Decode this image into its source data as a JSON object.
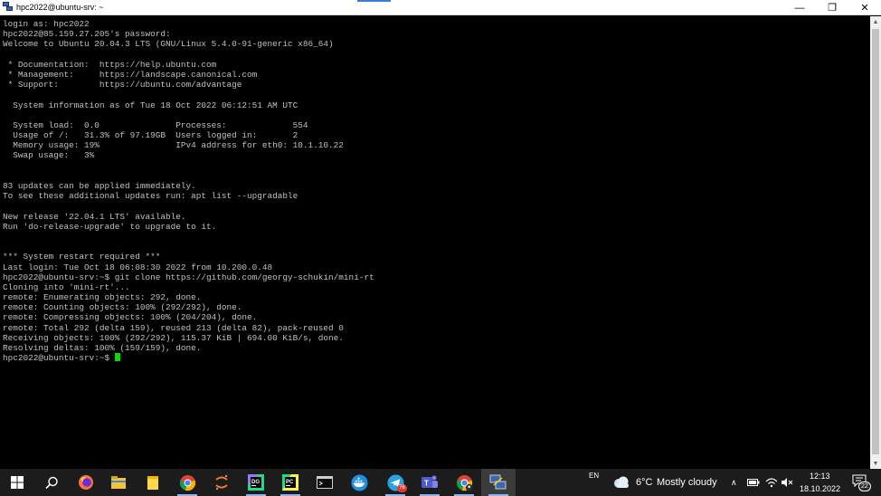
{
  "window": {
    "title": "hpc2022@ubuntu-srv: ~",
    "minimize_glyph": "—",
    "maximize_glyph": "❐",
    "close_glyph": "✕"
  },
  "terminal": {
    "lines": [
      "login as: hpc2022",
      "hpc2022@85.159.27.205's password:",
      "Welcome to Ubuntu 20.04.3 LTS (GNU/Linux 5.4.0-91-generic x86_64)",
      "",
      " * Documentation:  https://help.ubuntu.com",
      " * Management:     https://landscape.canonical.com",
      " * Support:        https://ubuntu.com/advantage",
      "",
      "  System information as of Tue 18 Oct 2022 06:12:51 AM UTC",
      "",
      "  System load:  0.0               Processes:             554",
      "  Usage of /:   31.3% of 97.19GB  Users logged in:       2",
      "  Memory usage: 19%               IPv4 address for eth0: 10.1.10.22",
      "  Swap usage:   3%",
      "",
      "",
      "83 updates can be applied immediately.",
      "To see these additional updates run: apt list --upgradable",
      "",
      "New release '22.04.1 LTS' available.",
      "Run 'do-release-upgrade' to upgrade to it.",
      "",
      "",
      "*** System restart required ***",
      "Last login: Tue Oct 18 06:08:30 2022 from 10.200.0.48",
      "hpc2022@ubuntu-srv:~$ git clone https://github.com/georgy-schukin/mini-rt",
      "Cloning into 'mini-rt'...",
      "remote: Enumerating objects: 292, done.",
      "remote: Counting objects: 100% (292/292), done.",
      "remote: Compressing objects: 100% (204/204), done.",
      "remote: Total 292 (delta 159), reused 213 (delta 82), pack-reused 0",
      "Receiving objects: 100% (292/292), 115.37 KiB | 694.00 KiB/s, done.",
      "Resolving deltas: 100% (159/159), done."
    ],
    "prompt": "hpc2022@ubuntu-srv:~$ ",
    "cursor_color": "#00e000",
    "text_color": "#c0c0c0"
  },
  "taskbar": {
    "language": "EN",
    "weather": {
      "temp": "6°C",
      "condition": "Mostly cloudy"
    },
    "time": "12:13",
    "date": "18.10.2022",
    "notification_count": "22",
    "telegram_badge": "76",
    "apps": [
      {
        "icon": "windows-start-icon"
      },
      {
        "icon": "search-icon"
      },
      {
        "icon": "firefox-icon"
      },
      {
        "icon": "file-explorer-icon"
      },
      {
        "icon": "sticky-notes-icon"
      },
      {
        "icon": "chrome-icon"
      },
      {
        "icon": "jupyter-icon"
      },
      {
        "icon": "datagrip-icon"
      },
      {
        "icon": "pycharm-icon"
      },
      {
        "icon": "terminal-icon"
      },
      {
        "icon": "docker-icon"
      },
      {
        "icon": "telegram-icon"
      },
      {
        "icon": "teams-icon"
      },
      {
        "icon": "chrome-profile-icon"
      },
      {
        "icon": "putty-icon"
      }
    ]
  }
}
